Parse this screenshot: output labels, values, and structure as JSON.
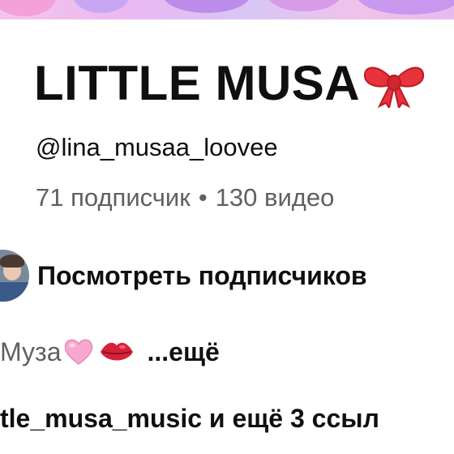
{
  "channel": {
    "title": "LITTLE MUSA",
    "handle": "@lina_musaa_loovee",
    "subscribers": "71 подписчик",
    "separator": "•",
    "videos": "130 видео"
  },
  "subscribers_row": {
    "label": "Посмотреть подписчиков"
  },
  "description": {
    "text": "Муза",
    "more_label": "...ещё"
  },
  "links": {
    "primary": "tle_musa_music",
    "more": " и ещё 3 ссыл"
  },
  "colors": {
    "text": "#0f0f0f",
    "secondary": "#606060",
    "bow": "#e8323c",
    "heart": "#f8a8cf",
    "lips": "#d6213a"
  }
}
